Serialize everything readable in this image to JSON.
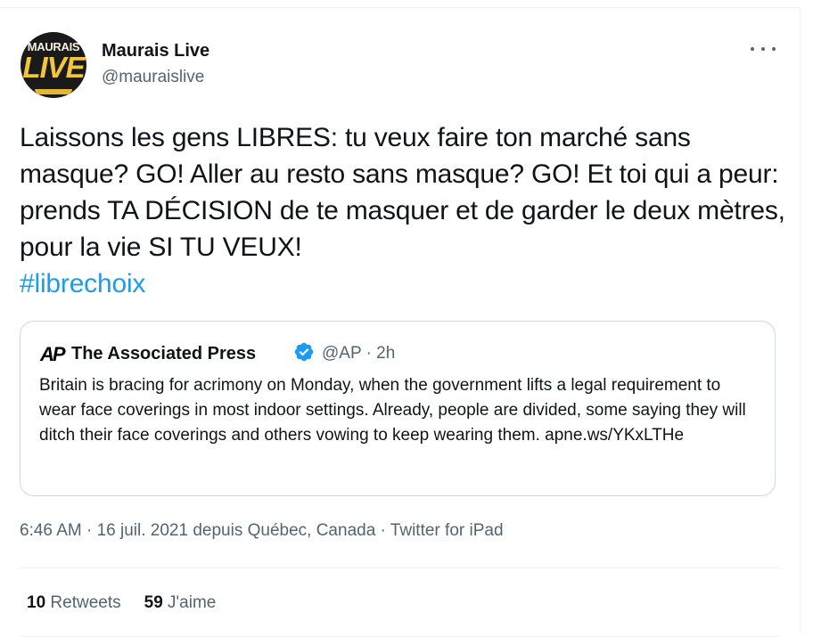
{
  "author": {
    "name": "Maurais Live",
    "handle": "@mauraislive",
    "avatar_top_text": "MAURAIS",
    "avatar_bottom_text": "LIVE"
  },
  "tweet": {
    "text": "Laissons les gens LIBRES: tu veux faire ton marché sans masque? GO! Aller au resto sans masque? GO! Et toi qui a peur: prends TA DÉCISION de te masquer et de garder le deux mètres, pour la vie SI TU VEUX!",
    "hashtag": "#librechoix",
    "timestamp": "6:46 AM · 16 juil. 2021 depuis Québec, Canada · Twitter for iPad"
  },
  "quote": {
    "logo": "AP",
    "name": "The Associated Press",
    "meta": "@AP · 2h",
    "text": "Britain is bracing for acrimony on Monday, when the government lifts a legal requirement to wear face coverings in most indoor settings. Already, people are divided, some saying they will ditch their face coverings and others vowing to keep wearing them. apne.ws/YKxLTHe"
  },
  "stats": {
    "retweets_count": "10",
    "retweets_label": "Retweets",
    "likes_count": "59",
    "likes_label": "J'aime"
  },
  "colors": {
    "accent": "#1d9bf0",
    "secondary_text": "#536471",
    "border": "#cfd9de"
  },
  "icons": {
    "more": "more-horizontal-icon",
    "verified": "verified-badge-icon"
  }
}
